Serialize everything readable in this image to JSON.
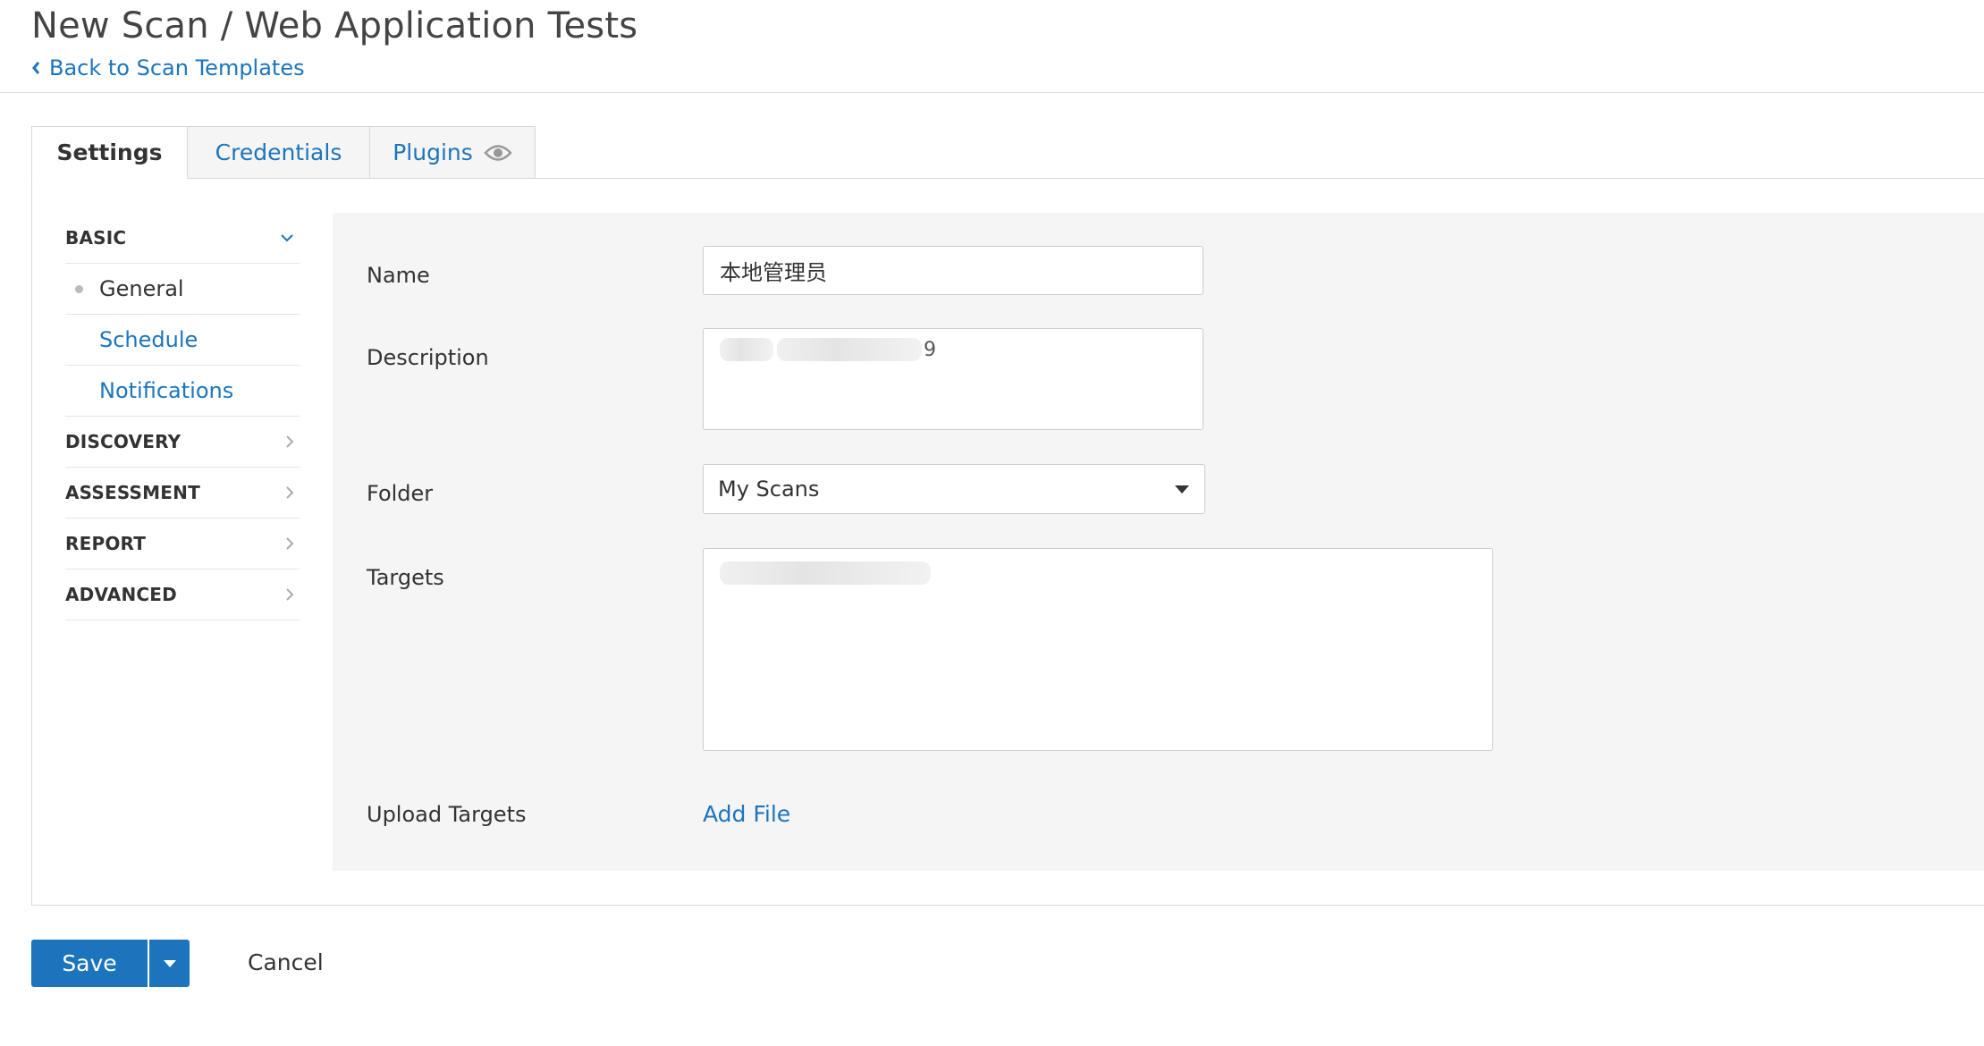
{
  "header": {
    "title": "New Scan / Web Application Tests",
    "back_link": "Back to Scan Templates"
  },
  "tabs": [
    {
      "label": "Settings"
    },
    {
      "label": "Credentials"
    },
    {
      "label": "Plugins"
    }
  ],
  "sidebar": {
    "basic": "BASIC",
    "basic_items": [
      "General",
      "Schedule",
      "Notifications"
    ],
    "discovery": "DISCOVERY",
    "assessment": "ASSESSMENT",
    "report": "REPORT",
    "advanced": "ADVANCED"
  },
  "form": {
    "name_label": "Name",
    "name_value": "本地管理员",
    "description_label": "Description",
    "description_visible_head": "",
    "description_visible_tail": "9",
    "folder_label": "Folder",
    "folder_value": "My Scans",
    "targets_label": "Targets",
    "upload_label": "Upload Targets",
    "add_file": "Add File"
  },
  "actions": {
    "save": "Save",
    "cancel": "Cancel"
  },
  "colors": {
    "accent": "#1c75bc",
    "panel_bg": "#f5f5f5"
  },
  "icons": {
    "back": "chevron-left-icon",
    "plugins_view": "eye-icon",
    "basic_expanded": "chevron-down-icon",
    "section_collapsed": "chevron-right-icon",
    "dropdown": "caret-down-icon"
  }
}
